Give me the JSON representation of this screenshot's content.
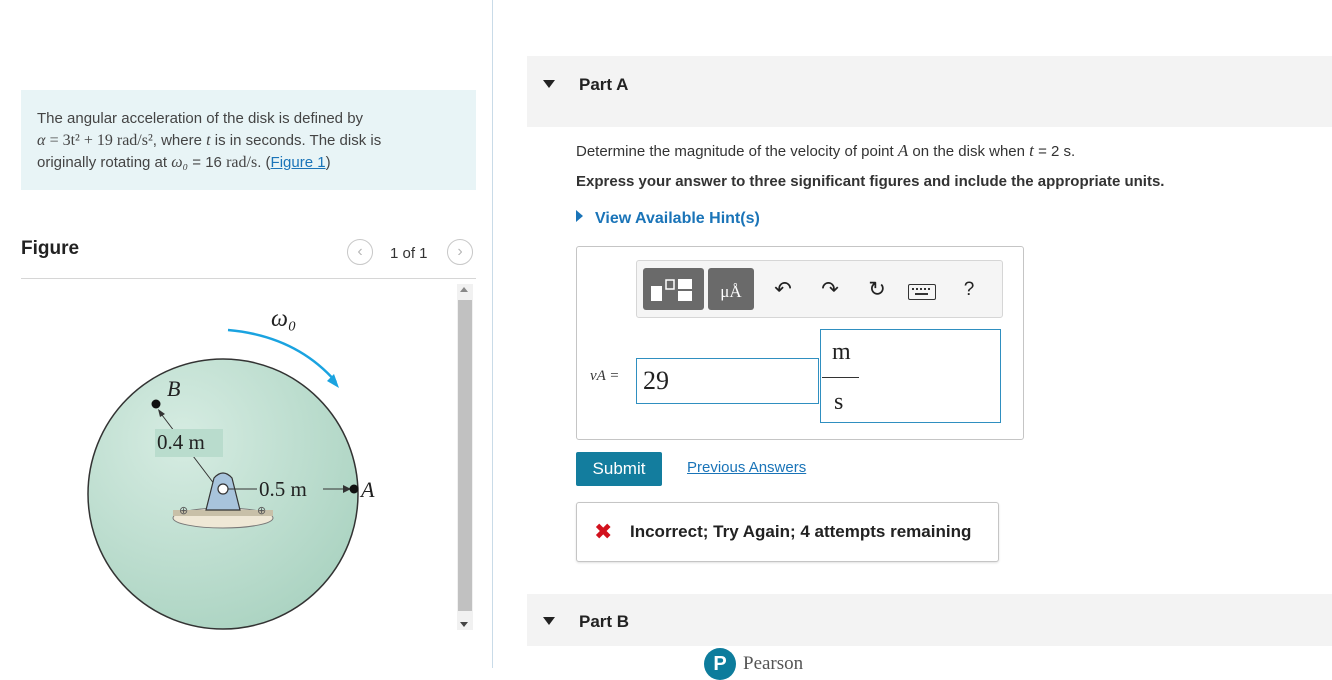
{
  "problem": {
    "line1": "The angular acceleration of the disk is defined by",
    "alpha_symbol": "α",
    "equation": "= 3t² + 19 rad/s²",
    "line2_suffix": ", where",
    "t_symbol": "t",
    "line2_end": "is in seconds. The disk is",
    "line3_prefix": "originally rotating at",
    "omega0_symbol": "ω₀",
    "line3_value": "= 16",
    "line3_unit": "rad/s",
    "link_text": "Figure 1",
    "line3_close": "."
  },
  "figure": {
    "title": "Figure",
    "pager_text": "1 of 1",
    "prev_icon": "chevron-left-icon",
    "next_icon": "chevron-right-icon",
    "labels": {
      "omega": "ω₀",
      "point_b": "B",
      "radius_b": "0.4 m",
      "radius_a": "0.5 m",
      "point_a": "A"
    },
    "colors": {
      "disk": "#b8dbcc",
      "arrow": "#1aa3e0",
      "support": "#a8c4dc",
      "base": "#efe8d6"
    }
  },
  "part_a": {
    "label": "Part A",
    "question_prefix": "Determine the magnitude of the velocity of point",
    "point_symbol": "A",
    "question_mid": "on the disk when",
    "t_symbol": "t",
    "question_end": "= 2 s.",
    "instruction": "Express your answer to three significant figures and include the appropriate units.",
    "hint_label": "View Available Hint(s)",
    "toolbar": {
      "icons": [
        "templates-icon",
        "units-icon",
        "undo-icon",
        "redo-icon",
        "reset-icon",
        "keyboard-icon",
        "help-icon"
      ],
      "units_label": "μÅ",
      "help_label": "?"
    },
    "variable_label": "vA =",
    "value": "29",
    "unit_numerator": "m",
    "unit_denominator": "s",
    "submit_label": "Submit",
    "previous_answers_label": "Previous Answers",
    "feedback_text": "Incorrect; Try Again; 4 attempts remaining",
    "feedback_icon": "x-icon"
  },
  "part_b": {
    "label": "Part B"
  },
  "footer": {
    "brand": "Pearson",
    "logo_letter": "P"
  }
}
